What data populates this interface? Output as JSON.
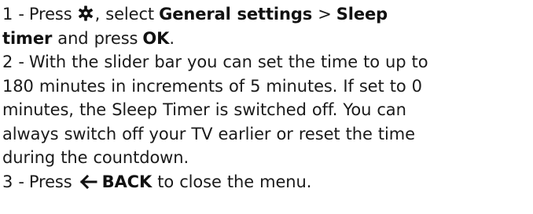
{
  "steps": [
    {
      "number": "1 -",
      "press": "Press",
      "gear_icon": "gear-icon",
      "after_icon": ", select",
      "menu_path": "General settings",
      "separator": ">",
      "item_a": "Sleep",
      "item_b": "timer",
      "and_press": "and press",
      "ok": "OK",
      "end": "."
    },
    {
      "number": "2 -",
      "lines": [
        "With the slider bar you can set the time to up to",
        "180 minutes in increments of 5 minutes. If set to 0",
        "minutes, the Sleep Timer is switched off. You can",
        "always switch off your TV earlier or reset the time",
        "during the countdown."
      ]
    },
    {
      "number": "3 -",
      "press": "Press",
      "back_icon": "back-arrow-icon",
      "back_label": "BACK",
      "rest": "to close the menu."
    }
  ]
}
